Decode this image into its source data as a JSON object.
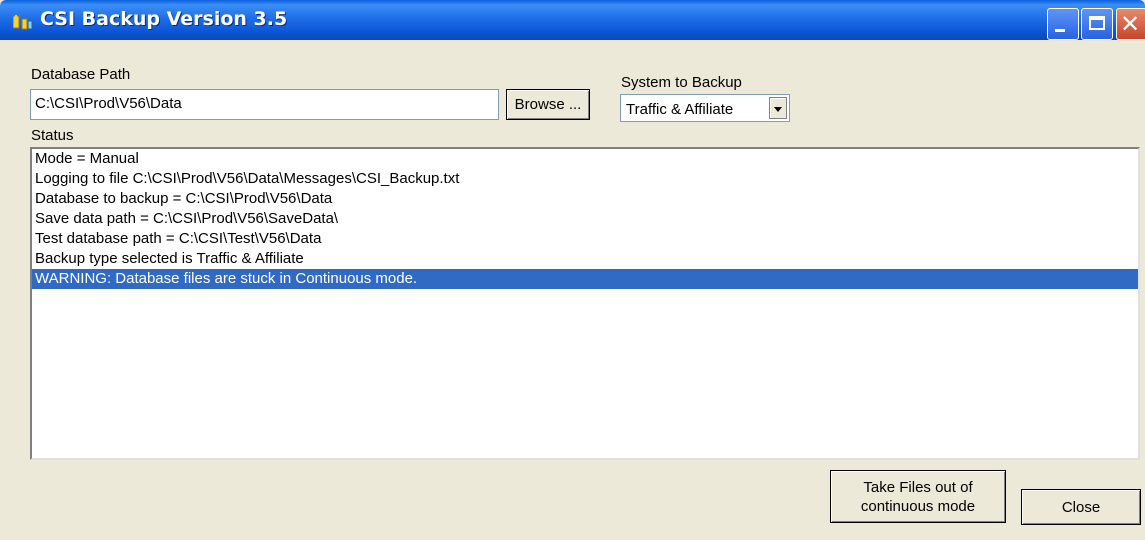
{
  "window": {
    "title": "CSI Backup Version 3.5"
  },
  "database_path": {
    "label": "Database Path",
    "value": "C:\\CSI\\Prod\\V56\\Data",
    "browse_label": "Browse ..."
  },
  "system_to_backup": {
    "label": "System to Backup",
    "selected": "Traffic & Affiliate"
  },
  "status": {
    "label": "Status",
    "lines": [
      "Mode = Manual",
      "Logging to file C:\\CSI\\Prod\\V56\\Data\\Messages\\CSI_Backup.txt",
      "Database to backup = C:\\CSI\\Prod\\V56\\Data",
      "Save data path = C:\\CSI\\Prod\\V56\\SaveData\\",
      "Test database path = C:\\CSI\\Test\\V56\\Data",
      "Backup type selected is Traffic & Affiliate",
      "WARNING: Database files are stuck in Continuous mode."
    ],
    "selected_index": 6
  },
  "actions": {
    "take_files_line1": "Take Files out of",
    "take_files_line2": "continuous mode",
    "close_label": "Close"
  },
  "colors": {
    "titlebar": "#0b55d6",
    "selection": "#316ac5",
    "window_bg": "#ece9d8"
  }
}
